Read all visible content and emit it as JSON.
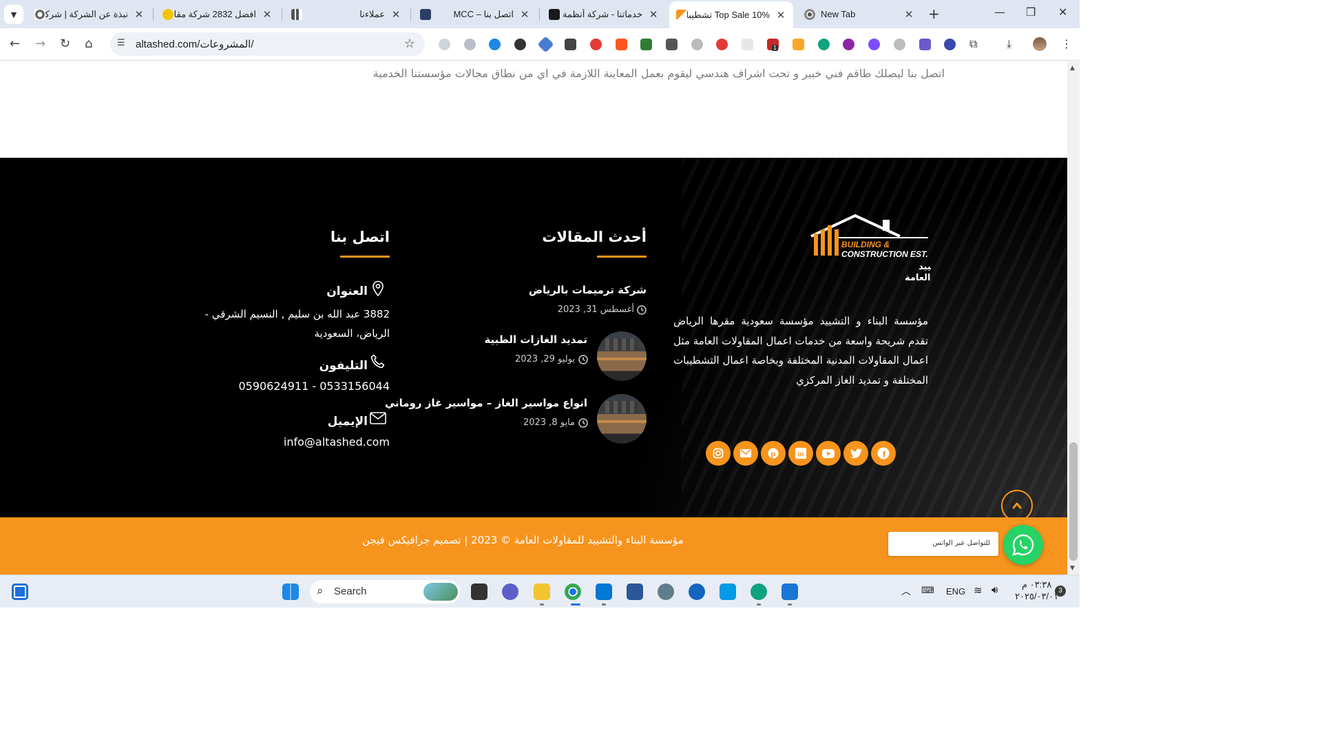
{
  "browser": {
    "tabs": [
      {
        "title": "نبذة عن الشركة | شركة",
        "active": false
      },
      {
        "title": "افضل 2832 شركة مقاو",
        "active": false
      },
      {
        "title": "عملاءنا",
        "active": false
      },
      {
        "title": "اتصل بنا – MCC",
        "active": false
      },
      {
        "title": "خدماتنا - شركة أنظمة",
        "active": false
      },
      {
        "title": "Top Sale 10% تشطيبات",
        "active": true
      },
      {
        "title": "New Tab",
        "active": false
      }
    ],
    "url": "altashed.com/المشروعات/",
    "extension_badge": "1"
  },
  "page": {
    "intro_text": "اتصل بنا ليصلك طاقم فني خبير و تحت اشراف هندسي ليقوم بعمل المعاينة اللازمة في اي من نطاق مجالات مؤسستنا الخدمية",
    "logo": {
      "line1": "BUILDING &",
      "line2": "CONSTRUCTION EST.",
      "line3": "مؤسسة البناء والتشييد",
      "line4": "للمقاولات العامة"
    },
    "about": "مؤسسة البناء و التشييد مؤسسة سعودية  مقرها الرياض تقدم شريحة واسعة من خدمات اعمال المقاولات العامة مثل اعمال المقاولات المدنية المختلفة وبخاصة اعمال التشطيبات المختلفة و تمديد الغاز المركزي",
    "socials": [
      "instagram",
      "email",
      "pinterest",
      "linkedin",
      "youtube",
      "twitter",
      "facebook"
    ],
    "articles": {
      "heading": "أحدث المقالات",
      "items": [
        {
          "title": "شركة ترميمات بالرياض",
          "date": "أغسطس 31, 2023"
        },
        {
          "title": "تمديد الغازات الطبية",
          "date": "يوليو 29, 2023"
        },
        {
          "title": "انواع مواسير الغاز – مواسير غاز روماني",
          "date": "مايو 8, 2023"
        }
      ]
    },
    "contact": {
      "heading": "اتصل بنا",
      "address_label": "العنوان",
      "address_value": "3882 عبد الله بن سليم , النسيم الشرقي - الرياض، السعودية",
      "phone_label": "التليفون",
      "phone_value": "0590624911 - 0533156044",
      "email_label": "الإيميل",
      "email_value": "info@altashed.com"
    },
    "copyright": "مؤسسة البناء والتشييد للمقاولات العامة ©  2023  |  تصميم جرافيكس فيجن",
    "whatsapp_placeholder": "للتواصل عبر الواتس"
  },
  "taskbar": {
    "search_label": "Search",
    "language": "ENG",
    "time": "٠٣:٣٨ م",
    "date": "٢٠٢٥/٠٣/٠١",
    "notification_count": "3"
  },
  "colors": {
    "accent": "#f7941d",
    "footer_bg": "#000000",
    "whatsapp": "#25d366"
  }
}
